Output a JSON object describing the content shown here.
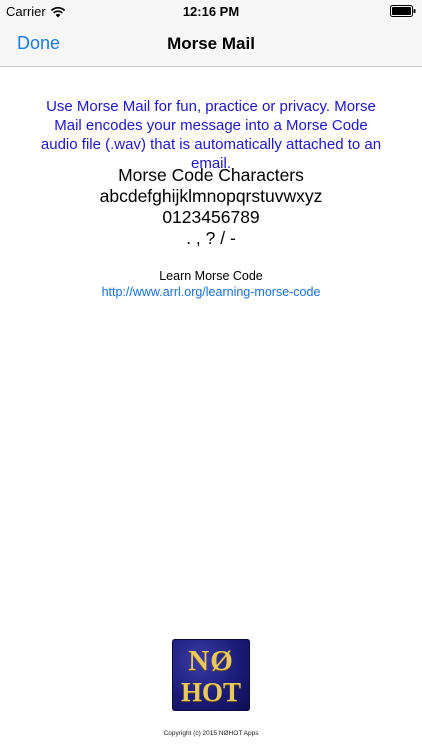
{
  "status_bar": {
    "carrier": "Carrier",
    "time": "12:16 PM",
    "wifi_icon": "wifi-icon",
    "battery_icon": "battery-icon"
  },
  "nav": {
    "done_label": "Done",
    "title": "Morse Mail"
  },
  "intro_text": "Use Morse Mail for fun, practice or privacy. Morse Mail encodes your message into a Morse Code audio file (.wav) that is automatically attached to an email.",
  "characters": {
    "heading": "Morse Code Characters",
    "letters": "abcdefghijklmnopqrstuvwxyz",
    "digits": "0123456789",
    "punctuation": ". , ? / -"
  },
  "learn": {
    "title": "Learn Morse Code",
    "link": "http://www.arrl.org/learning-morse-code"
  },
  "logo": {
    "line1": "NØ",
    "line2": "HOT"
  },
  "footer": {
    "copyright": "Copyright (c) 2015 NØHOT Apps"
  },
  "colors": {
    "accent_blue": "#1a7ce6",
    "intro_text": "#1d17c9",
    "link": "#1a6fdc",
    "logo_bg": "#1b1b78",
    "logo_gold": "#e9c95b"
  }
}
